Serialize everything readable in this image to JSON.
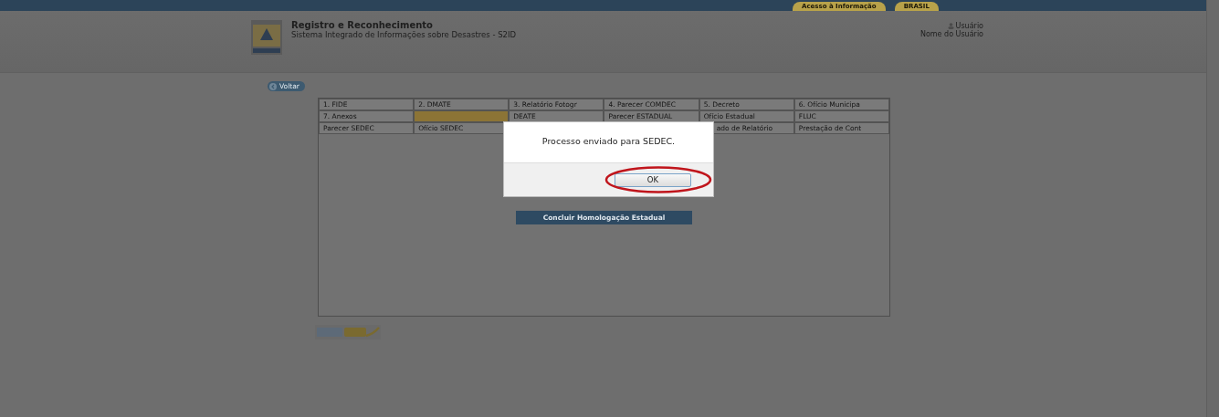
{
  "top_bar": {
    "links": [
      {
        "label": "Acesso à Informação"
      },
      {
        "label": "BRASIL"
      }
    ]
  },
  "header": {
    "title": "Registro e Reconhecimento",
    "subtitle": "Sistema Integrado de Informações sobre Desastres - S2ID",
    "user_label": "Usuário",
    "user_name": "Nome do Usuário"
  },
  "back_button": {
    "label": "Voltar"
  },
  "tabs": [
    {
      "label": "1. FIDE",
      "selected": false
    },
    {
      "label": "2. DMATE",
      "selected": false
    },
    {
      "label": "3. Relatório Fotogr",
      "selected": false
    },
    {
      "label": "4. Parecer COMDEC",
      "selected": false
    },
    {
      "label": "5. Decreto",
      "selected": false
    },
    {
      "label": "6. Ofício Municipa",
      "selected": false
    },
    {
      "label": "7. Anexos",
      "selected": false
    },
    {
      "selected": true
    },
    {
      "label": "DEATE",
      "selected": false
    },
    {
      "label": "Parecer ESTADUAL",
      "selected": false
    },
    {
      "label": "Ofício Estadual",
      "selected": false
    },
    {
      "label": "FLUC",
      "selected": false
    },
    {
      "label": "Parecer SEDEC",
      "selected": false
    },
    {
      "label": "Ofício SEDEC",
      "selected": false
    },
    {
      "label": "ado de Relatório",
      "selected": false
    },
    {
      "label": "Prestação de Cont",
      "selected": false
    }
  ],
  "action_button": {
    "label": "Concluir Homologação Estadual"
  },
  "dialog": {
    "message": "Processo enviado para SEDEC.",
    "ok": "OK"
  }
}
